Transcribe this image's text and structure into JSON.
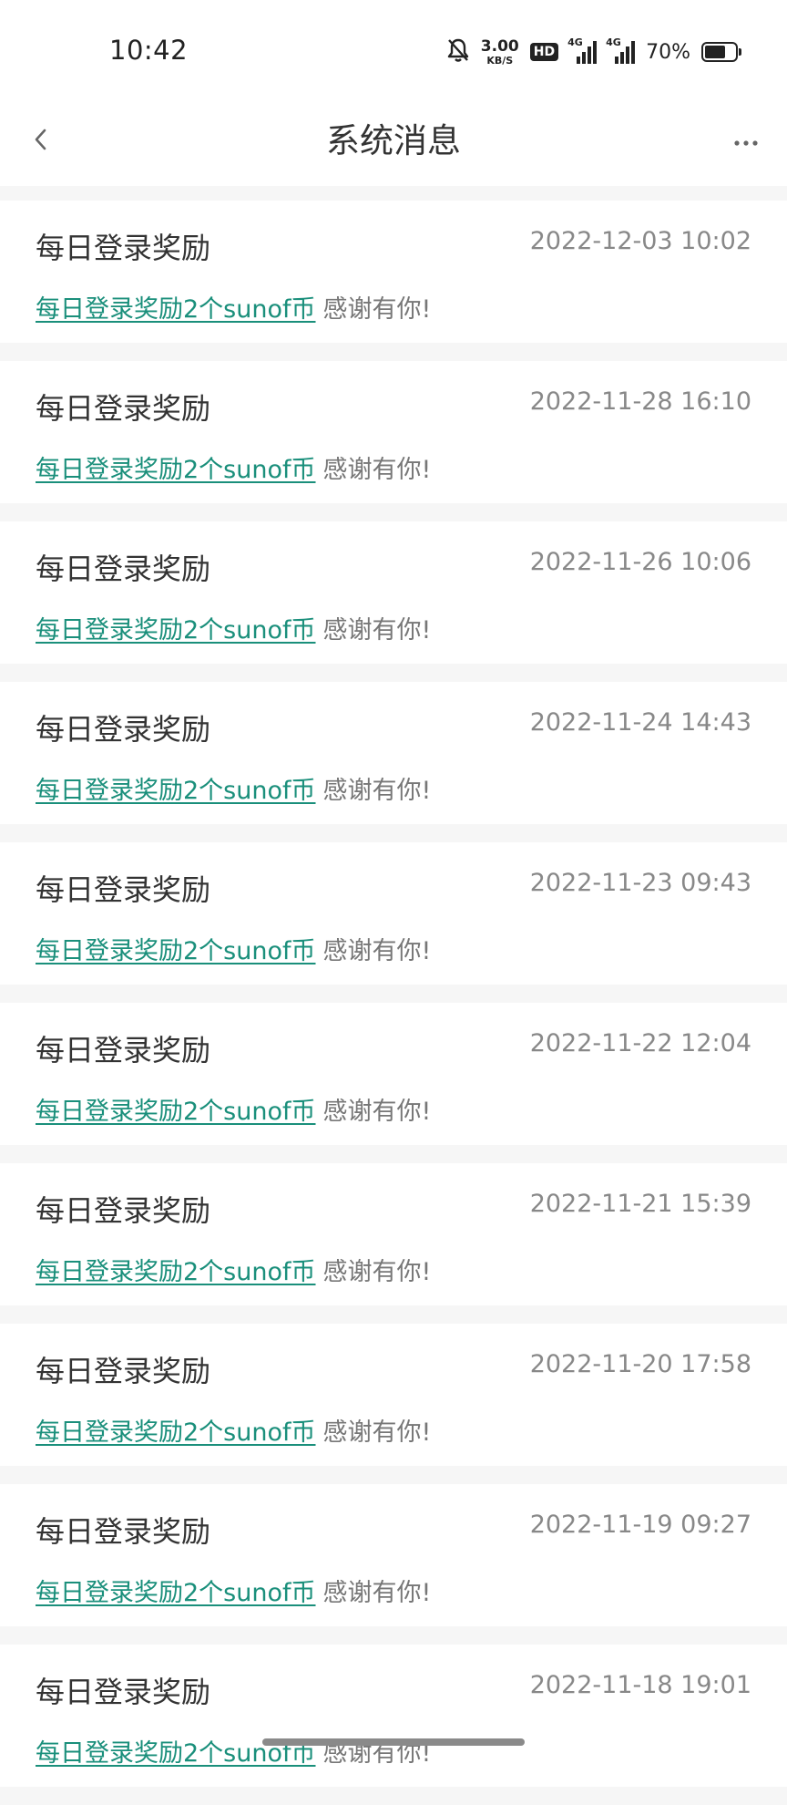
{
  "status_bar": {
    "time": "10:42",
    "net_speed_value": "3.00",
    "net_speed_unit": "KB/S",
    "hd_badge": "HD",
    "sim1_label": "4G",
    "sim2_label": "4G",
    "battery_percent": "70%",
    "battery_level": 0.7,
    "icons": [
      "bell-muted-icon",
      "hd-icon",
      "signal-icon",
      "signal-icon",
      "battery-icon"
    ]
  },
  "nav": {
    "title": "系统消息",
    "back_icon": "chevron-left-icon",
    "more_icon": "ellipsis-icon"
  },
  "messages": [
    {
      "title": "每日登录奖励",
      "time": "2022-12-03 10:02",
      "link_text": "每日登录奖励2个sunof币",
      "suffix": "感谢有你!"
    },
    {
      "title": "每日登录奖励",
      "time": "2022-11-28 16:10",
      "link_text": "每日登录奖励2个sunof币",
      "suffix": "感谢有你!"
    },
    {
      "title": "每日登录奖励",
      "time": "2022-11-26 10:06",
      "link_text": "每日登录奖励2个sunof币",
      "suffix": "感谢有你!"
    },
    {
      "title": "每日登录奖励",
      "time": "2022-11-24 14:43",
      "link_text": "每日登录奖励2个sunof币",
      "suffix": "感谢有你!"
    },
    {
      "title": "每日登录奖励",
      "time": "2022-11-23 09:43",
      "link_text": "每日登录奖励2个sunof币",
      "suffix": "感谢有你!"
    },
    {
      "title": "每日登录奖励",
      "time": "2022-11-22 12:04",
      "link_text": "每日登录奖励2个sunof币",
      "suffix": "感谢有你!"
    },
    {
      "title": "每日登录奖励",
      "time": "2022-11-21 15:39",
      "link_text": "每日登录奖励2个sunof币",
      "suffix": "感谢有你!"
    },
    {
      "title": "每日登录奖励",
      "time": "2022-11-20 17:58",
      "link_text": "每日登录奖励2个sunof币",
      "suffix": "感谢有你!"
    },
    {
      "title": "每日登录奖励",
      "time": "2022-11-19 09:27",
      "link_text": "每日登录奖励2个sunof币",
      "suffix": "感谢有你!"
    },
    {
      "title": "每日登录奖励",
      "time": "2022-11-18 19:01",
      "link_text": "每日登录奖励2个sunof币",
      "suffix": "感谢有你!"
    }
  ],
  "colors": {
    "link": "#1a8f7b",
    "background": "#f6f6f6",
    "card": "#ffffff"
  }
}
